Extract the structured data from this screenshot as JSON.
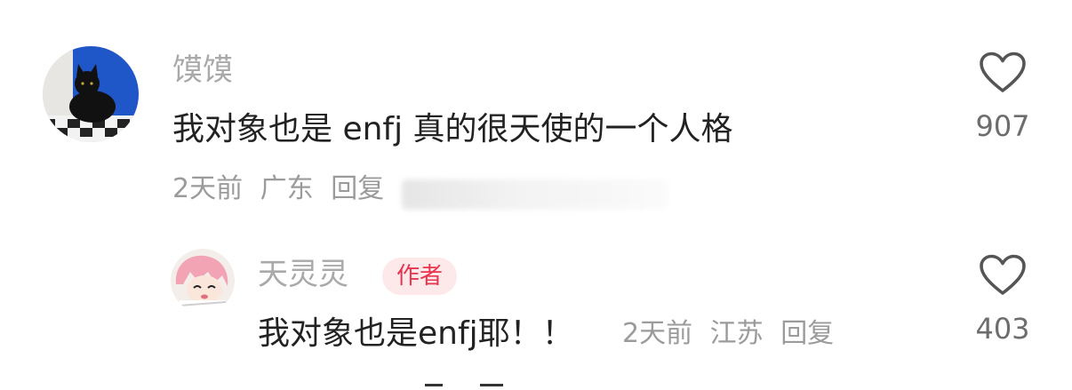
{
  "comments": [
    {
      "username": "馍馍",
      "text": "我对象也是 enfj 真的很天使的一个人格",
      "time": "2天前",
      "location": "广东",
      "reply_label": "回复",
      "likes": "907"
    }
  ],
  "reply": {
    "username": "天灵灵",
    "author_badge": "作者",
    "text": "我对象也是enfj耶！！",
    "time": "2天前",
    "location": "江苏",
    "reply_label": "回复",
    "likes": "403"
  },
  "colors": {
    "username": "#a9a9a9",
    "content": "#222222",
    "meta": "#9b9b9b",
    "like_count": "#6d6d6d",
    "author_badge_bg": "#fde8ea",
    "author_badge_text": "#e8344e"
  },
  "icons": {
    "like": "heart-outline-icon"
  }
}
